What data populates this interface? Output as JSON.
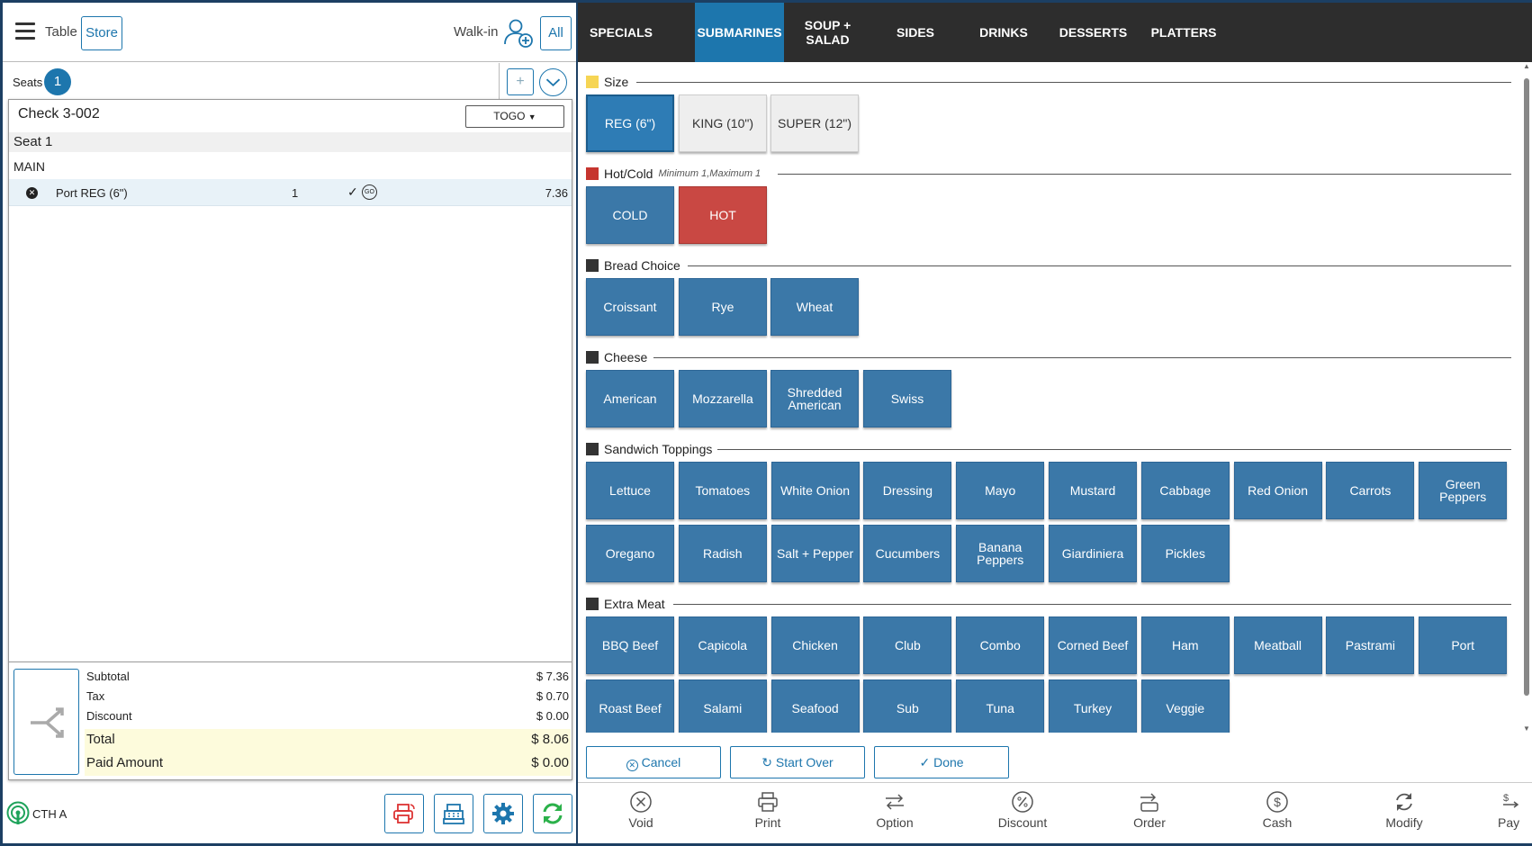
{
  "header": {
    "table_label": "Table",
    "store_label": "Store",
    "walkin_label": "Walk-in",
    "all_label": "All"
  },
  "seats": {
    "label": "Seats",
    "count": "1",
    "add_label": "+"
  },
  "check": {
    "title": "Check 3-002",
    "order_type": "TOGO",
    "seat_label": "Seat 1",
    "course_label": "MAIN",
    "items": [
      {
        "name": "Port REG (6\")",
        "qty": "1",
        "go": "GO",
        "price": "7.36"
      }
    ]
  },
  "totals": {
    "subtotal_label": "Subtotal",
    "subtotal": "$ 7.36",
    "tax_label": "Tax",
    "tax": "$ 0.70",
    "discount_label": "Discount",
    "discount": "$ 0.00",
    "total_label": "Total",
    "total": "$ 8.06",
    "paid_label": "Paid Amount",
    "paid": "$ 0.00"
  },
  "station": {
    "name": "CTH A"
  },
  "categories": [
    "SPECIALS",
    "SUBMARINES",
    "SOUP + SALAD",
    "SIDES",
    "DRINKS",
    "DESSERTS",
    "PLATTERS"
  ],
  "active_category": "SUBMARINES",
  "modifier_groups": {
    "size": {
      "title": "Size",
      "color": "#f6d554",
      "options": [
        "REG (6\")",
        "KING (10\")",
        "SUPER (12\")"
      ]
    },
    "hotcold": {
      "title": "Hot/Cold",
      "note": "Minimum 1,Maximum 1",
      "color": "#c6352f",
      "options": [
        "COLD",
        "HOT"
      ]
    },
    "bread": {
      "title": "Bread Choice",
      "color": "#333333",
      "options": [
        "Croissant",
        "Rye",
        "Wheat"
      ]
    },
    "cheese": {
      "title": "Cheese",
      "color": "#333333",
      "options": [
        "American",
        "Mozzarella",
        "Shredded American",
        "Swiss"
      ]
    },
    "toppings": {
      "title": "Sandwich Toppings",
      "color": "#333333",
      "options": [
        "Lettuce",
        "Tomatoes",
        "White Onion",
        "Dressing",
        "Mayo",
        "Mustard",
        "Cabbage",
        "Red Onion",
        "Carrots",
        "Green Peppers",
        "Oregano",
        "Radish",
        "Salt + Pepper",
        "Cucumbers",
        "Banana Peppers",
        "Giardiniera",
        "Pickles"
      ]
    },
    "meat": {
      "title": "Extra Meat",
      "color": "#333333",
      "options": [
        "BBQ Beef",
        "Capicola",
        "Chicken",
        "Club",
        "Combo",
        "Corned Beef",
        "Ham",
        "Meatball",
        "Pastrami",
        "Port",
        "Roast Beef",
        "Salami",
        "Seafood",
        "Sub",
        "Tuna",
        "Turkey",
        "Veggie"
      ]
    }
  },
  "actions": {
    "cancel": "Cancel",
    "start_over": "Start Over",
    "done": "Done"
  },
  "footer": [
    "Void",
    "Print",
    "Option",
    "Discount",
    "Order",
    "Cash",
    "Modify",
    "Pay"
  ],
  "colors": {
    "accent": "#1d76ad",
    "tile": "#3b78a8",
    "hot": "#c94843",
    "highlight": "#fdfbdc"
  }
}
